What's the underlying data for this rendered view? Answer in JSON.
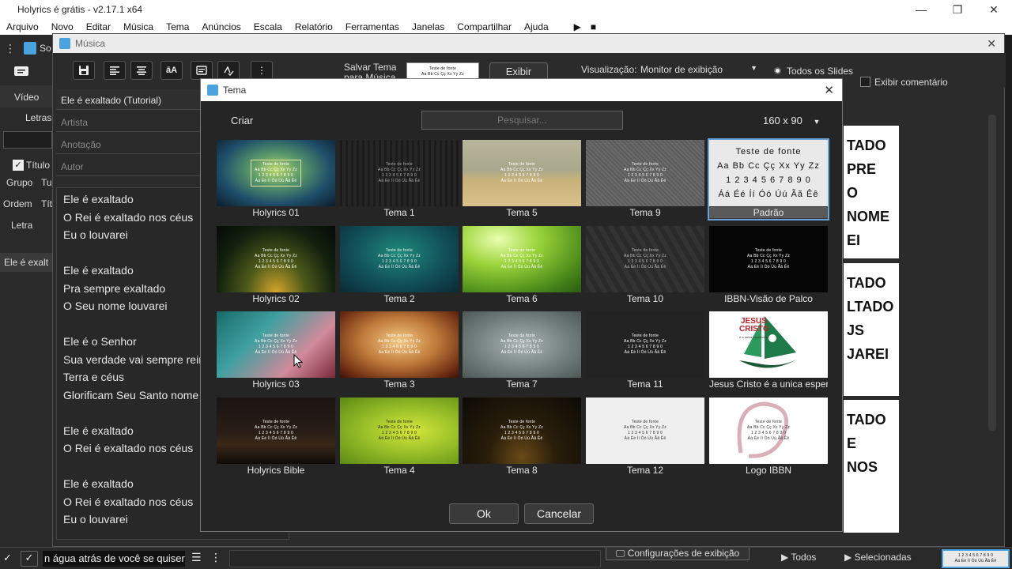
{
  "app": {
    "title": "Holyrics é grátis - v2.17.1 x64",
    "window_controls": [
      "—",
      "❐",
      "✕"
    ],
    "menu": [
      "Arquivo",
      "Novo",
      "Editar",
      "Música",
      "Tema",
      "Anúncios",
      "Escala",
      "Relatório",
      "Ferramentas",
      "Janelas",
      "Compartilhar",
      "Ajuda"
    ],
    "play_icon": "▶",
    "stop_icon": "■"
  },
  "left_panel": {
    "tab_partial": "So",
    "video_label": "Vídeo",
    "letras_label": "Letras",
    "titulo_label": "Título",
    "grupo_label": "Grupo",
    "grupo_value": "Tu",
    "ordem_label": "Ordem",
    "ordem_value": "Tít",
    "letra_label": "Letra",
    "list_item": "Ele é exalt"
  },
  "musica": {
    "title": "Música",
    "toolbar_more": "⋮",
    "salvar_tema": "Salvar Tema para Música",
    "salvar_tema_short": "Salvar Tema",
    "salvar_tema_line2": "para Música",
    "exibir_label": "Exibir",
    "visualizacao_label": "Visualização:",
    "visualizacao_value": "Monitor de exibição",
    "todos_slides": "Todos os Slides",
    "exibir_comentario": "Exibir comentário",
    "song_title": "Ele é exaltado (Tutorial)",
    "artista_placeholder": "Artista",
    "anotacao_placeholder": "Anotação",
    "autor_placeholder": "Autor",
    "lyrics": [
      "Ele é exaltado",
      "O Rei é exaltado nos céus",
      "Eu o louvarei",
      "",
      "Ele é exaltado",
      "Pra sempre exaltado",
      "O Seu nome louvarei",
      "",
      "Ele é o Senhor",
      "Sua verdade vai sempre reinar",
      "Terra e céus",
      "Glorificam Seu Santo nome",
      "",
      "Ele é exaltado",
      "O Rei é exaltado nos céus",
      "",
      "Ele é exaltado",
      "O Rei é exaltado nos céus",
      "Eu o louvarei"
    ],
    "preview_cards": [
      [
        "TADO",
        "PRE",
        "O",
        "NOME",
        "EI"
      ],
      [
        "TADO",
        "LTADO",
        "JS",
        "JAREI"
      ],
      [
        "TADO",
        "E",
        "NOS"
      ]
    ],
    "config_exibicao": "Configurações de exibição",
    "todos_btn": "Todos",
    "selecionadas_btn": "Selecionadas",
    "mini_preview_l1": "1 2 3 4 5 6 7 8 9 0",
    "mini_preview_l2": "Áá Éé Íí Óó Úú Ãã Êê"
  },
  "tema": {
    "title": "Tema",
    "criar": "Criar",
    "search_placeholder": "Pesquisar...",
    "size_value": "160 x 90",
    "ok": "Ok",
    "cancelar": "Cancelar",
    "sample_lines": [
      "Teste de fonte",
      "Aa Bb Cc Çç Xx Yy Zz",
      "1 2 3 4 5 6 7 8 9 0",
      "Áá Éé Íí Óó Úú Ãã Êê"
    ],
    "jesus_line1": "JESUS",
    "jesus_line2": "CRISTO",
    "jesus_line3": "é a única esperança",
    "themes": [
      {
        "name": "Holyrics 01",
        "selected": false,
        "bg": "radial-gradient(ellipse at 50% 45%, #b9d56a 0%, #5a9a6a 30%, #1f4f6a 65%, #0b1c2c 100%)",
        "fg": "#fff"
      },
      {
        "name": "Tema 1",
        "selected": false,
        "bg": "repeating-linear-gradient(90deg, #1b1b1b 0 3px, #262626 3px 7px)",
        "fg": "#aaa"
      },
      {
        "name": "Tema 5",
        "selected": false,
        "bg": "linear-gradient(180deg, #b8b59a 0%, #a9a88c 45%, #c8b27a 60%, #d8c28a 100%)",
        "fg": "#fff"
      },
      {
        "name": "Tema 9",
        "selected": false,
        "bg": "repeating-linear-gradient(45deg, #6a6a6a 0 2px, #5c5c5c 2px 4px)",
        "fg": "#eee"
      },
      {
        "name": "Padrão",
        "selected": true,
        "bg": "#e9e9e9",
        "fg": "#111"
      },
      {
        "name": "Holyrics 02",
        "selected": false,
        "bg": "radial-gradient(ellipse at 50% 100%, #d3a52a 0%, #4d5a1a 35%, #12200e 70%, #050a06 100%)",
        "fg": "#fff"
      },
      {
        "name": "Tema 2",
        "selected": false,
        "bg": "radial-gradient(ellipse at 50% 40%, #1e8a7a 0%, #12505a 55%, #0a2a35 100%)",
        "fg": "#eee"
      },
      {
        "name": "Tema 6",
        "selected": false,
        "bg": "radial-gradient(ellipse at 30% 20%, #e9ffb0 0%, #9ad33a 35%, #4a8a1a 75%, #2a5a10 100%)",
        "fg": "#fff"
      },
      {
        "name": "Tema 10",
        "selected": false,
        "bg": "repeating-linear-gradient(60deg, #2a2a2a 0 6px, #333 6px 12px)",
        "fg": "#bbb"
      },
      {
        "name": "IBBN-Visão de Palco",
        "selected": false,
        "bg": "#050505",
        "fg": "#fff"
      },
      {
        "name": "Holyrics 03",
        "selected": false,
        "bg": "linear-gradient(135deg, #1a6a6a 0%, #3fa0a0 35%, #d08a9a 70%, #7a2a3a 100%)",
        "fg": "#fff"
      },
      {
        "name": "Tema 3",
        "selected": false,
        "bg": "radial-gradient(ellipse at 50% 45%, #f2c884 0%, #c07a3a 45%, #6a2a12 85%, #3a120a 100%)",
        "fg": "#fff"
      },
      {
        "name": "Tema 7",
        "selected": false,
        "bg": "radial-gradient(ellipse at 50% 50%, #a8b5b2 0%, #6f7c7a 60%, #4e5956 100%)",
        "fg": "#fff"
      },
      {
        "name": "Tema 11",
        "selected": false,
        "bg": "#232323",
        "fg": "#fff"
      },
      {
        "name": "Jesus Cristo é a unica esperança",
        "selected": false,
        "bg": "#ffffff",
        "fg": "#222"
      },
      {
        "name": "Holyrics Bible",
        "selected": false,
        "bg": "linear-gradient(180deg, #1a1412 0%, #2a1e16 55%, #3a2818 70%, #0f0b09 100%)",
        "fg": "#fff"
      },
      {
        "name": "Tema 4",
        "selected": false,
        "bg": "radial-gradient(ellipse at 60% 50%, #d7e63a 0%, #9cc22a 45%, #5a8a14 100%)",
        "fg": "#222"
      },
      {
        "name": "Tema 8",
        "selected": false,
        "bg": "radial-gradient(ellipse at 50% 90%, #6a4a18 0%, #2a1e0a 40%, #0c0a06 100%)",
        "fg": "#fff"
      },
      {
        "name": "Tema 12",
        "selected": false,
        "bg": "#efefef",
        "fg": "#333"
      },
      {
        "name": "Logo IBBN",
        "selected": false,
        "bg": "#ffffff",
        "fg": "#333"
      }
    ]
  },
  "statusbar": {
    "marquee": "n água atrás de você se quiser",
    "list_icon": "☰",
    "more_icon": "⋮"
  },
  "colors": {
    "accent": "#4aa3df",
    "selection_border": "#6aa0d8",
    "dark_bg": "#252525"
  }
}
